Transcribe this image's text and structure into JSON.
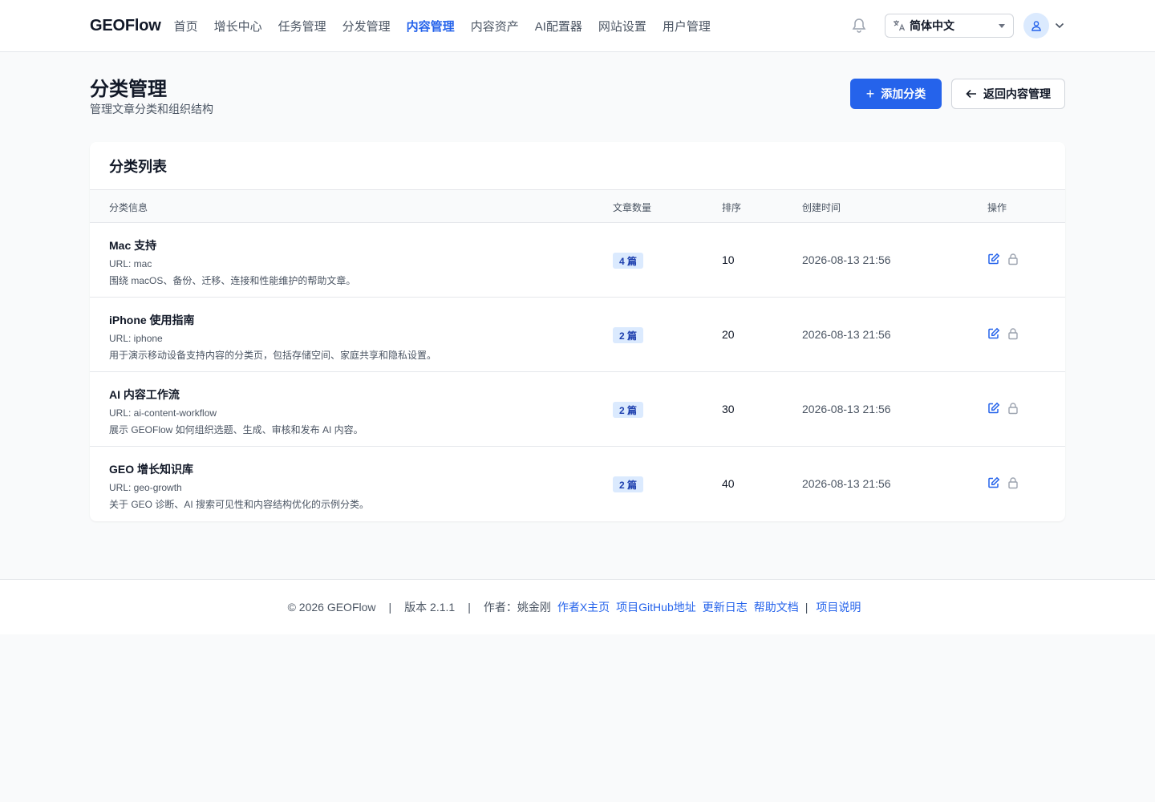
{
  "header": {
    "brand": "GEOFlow",
    "nav": [
      {
        "label": "首页",
        "active": false
      },
      {
        "label": "增长中心",
        "active": false
      },
      {
        "label": "任务管理",
        "active": false
      },
      {
        "label": "分发管理",
        "active": false
      },
      {
        "label": "内容管理",
        "active": true
      },
      {
        "label": "内容资产",
        "active": false
      },
      {
        "label": "AI配置器",
        "active": false
      },
      {
        "label": "网站设置",
        "active": false
      },
      {
        "label": "用户管理",
        "active": false
      }
    ],
    "language": "简体中文",
    "icons": {
      "bell": "bell-icon",
      "language": "translate-icon",
      "avatar": "user-icon",
      "menu": "chevron-down-icon"
    }
  },
  "page": {
    "title": "分类管理",
    "subtitle": "管理文章分类和组织结构",
    "add_button": "添加分类",
    "back_button": "返回内容管理"
  },
  "card": {
    "title": "分类列表",
    "columns": [
      "分类信息",
      "文章数量",
      "排序",
      "创建时间",
      "操作"
    ],
    "rows": [
      {
        "name": "Mac 支持",
        "url": "URL: mac",
        "desc": "围绕 macOS、备份、迁移、连接和性能维护的帮助文章。",
        "count": "4 篇",
        "sort": "10",
        "created": "2026-08-13 21:56"
      },
      {
        "name": "iPhone 使用指南",
        "url": "URL: iphone",
        "desc": "用于演示移动设备支持内容的分类页，包括存储空间、家庭共享和隐私设置。",
        "count": "2 篇",
        "sort": "20",
        "created": "2026-08-13 21:56"
      },
      {
        "name": "AI 内容工作流",
        "url": "URL: ai-content-workflow",
        "desc": "展示 GEOFlow 如何组织选题、生成、审核和发布 AI 内容。",
        "count": "2 篇",
        "sort": "30",
        "created": "2026-08-13 21:56"
      },
      {
        "name": "GEO 增长知识库",
        "url": "URL: geo-growth",
        "desc": "关于 GEO 诊断、AI 搜索可见性和内容结构优化的示例分类。",
        "count": "2 篇",
        "sort": "40",
        "created": "2026-08-13 21:56"
      }
    ]
  },
  "footer": {
    "copyright": "© 2026 GEOFlow",
    "version": "版本 2.1.1",
    "author": "作者：姚金刚",
    "links": [
      "作者X主页",
      "项目GitHub地址",
      "更新日志",
      "帮助文档",
      "项目说明"
    ]
  },
  "colors": {
    "accent": "#2563eb",
    "badge_bg": "#dbeafe",
    "badge_text": "#1e40af"
  }
}
